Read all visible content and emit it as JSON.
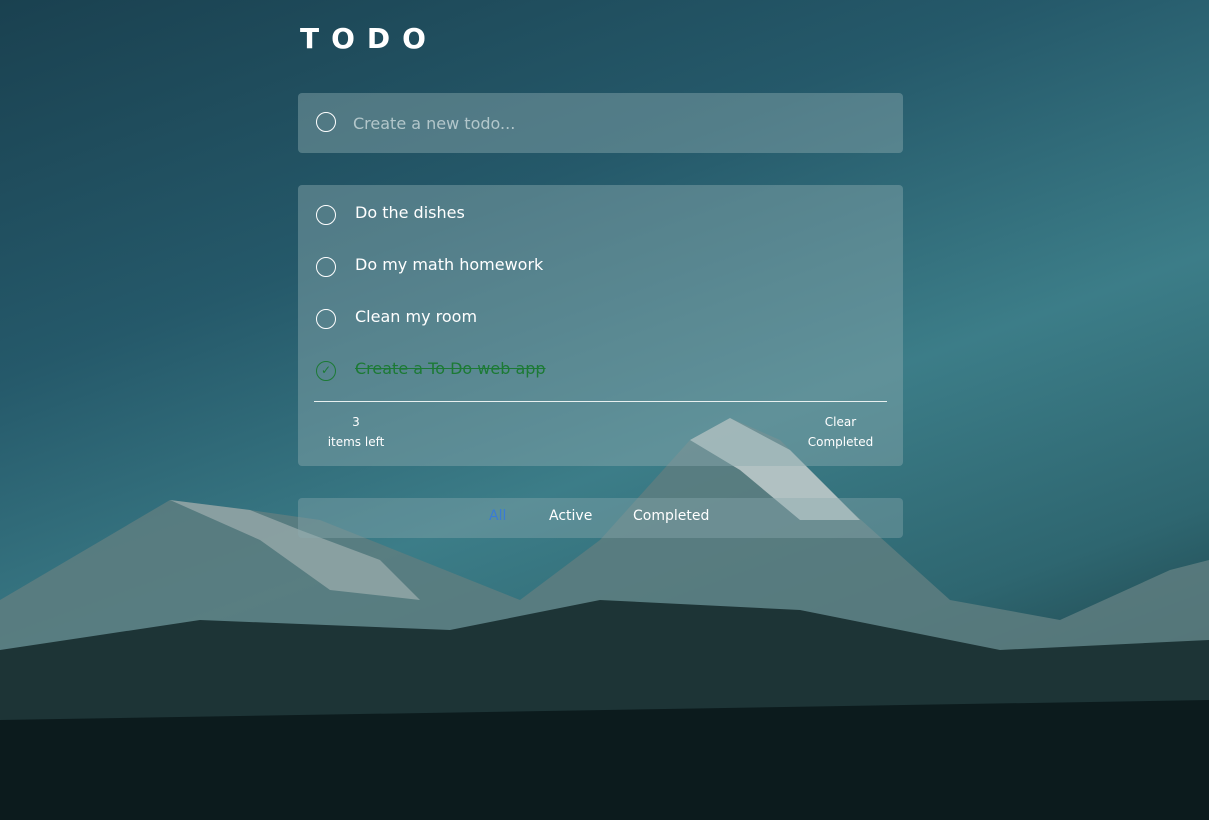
{
  "header": {
    "title": "TODO"
  },
  "new_todo": {
    "placeholder": "Create a new todo..."
  },
  "todos": [
    {
      "text": "Do the dishes",
      "completed": false
    },
    {
      "text": "Do my math homework",
      "completed": false
    },
    {
      "text": "Clean my room",
      "completed": false
    },
    {
      "text": "Create a To Do web app",
      "completed": true
    }
  ],
  "footer": {
    "count": "3",
    "items_left_label": "items left",
    "clear_line1": "Clear",
    "clear_line2": "Completed"
  },
  "filters": {
    "all": "All",
    "active": "Active",
    "completed": "Completed",
    "selected": "All"
  },
  "colors": {
    "accent": "#3a7bd5",
    "completed": "#1c7a35"
  },
  "icons": {
    "check": "check-circle-icon",
    "empty": "circle-icon"
  }
}
